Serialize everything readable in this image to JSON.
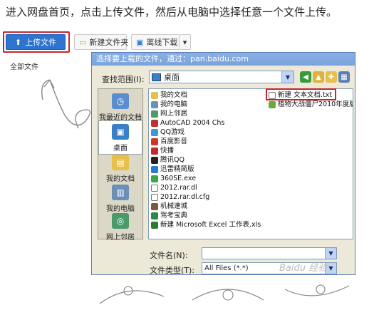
{
  "instruction": "进入网盘首页，点击上传文件，然后从电脑中选择任意一个文件上传。",
  "toolbar": {
    "upload_label": "上传文件",
    "new_folder_label": "新建文件夹",
    "offline_label": "离线下载",
    "more_label": "▾"
  },
  "all_files_label": "全部文件",
  "dialog": {
    "title": "选择要上载的文件，通过：pan.baidu.com",
    "look_in_label": "查找范围(I):",
    "look_in_value": "桌面",
    "places": [
      {
        "label": "我最近的文档",
        "icon": "recent-docs-icon"
      },
      {
        "label": "桌面",
        "icon": "desktop-icon"
      },
      {
        "label": "我的文档",
        "icon": "my-documents-icon"
      },
      {
        "label": "我的电脑",
        "icon": "my-computer-icon"
      },
      {
        "label": "网上邻居",
        "icon": "network-icon"
      }
    ],
    "files_col1": [
      "我的文档",
      "我的电脑",
      "网上邻居",
      "AutoCAD 2004 Chs",
      "QQ游戏",
      "百度影音",
      "快播",
      "腾讯QQ",
      "迅雷精简版",
      "360SE.exe",
      "2012.rar.dl",
      "2012.rar.dl.cfg",
      "机械速城",
      "驾考宝典",
      "新建 Microsoft Excel 工作表.xls"
    ],
    "files_col2": [
      "新建 文本文档.txt",
      "植物大战僵尸2010年度版"
    ],
    "file_name_label": "文件名(N):",
    "file_name_value": "",
    "file_type_label": "文件类型(T):",
    "file_type_value": "All Files (*.*)"
  },
  "watermark": "Baidu 经验"
}
